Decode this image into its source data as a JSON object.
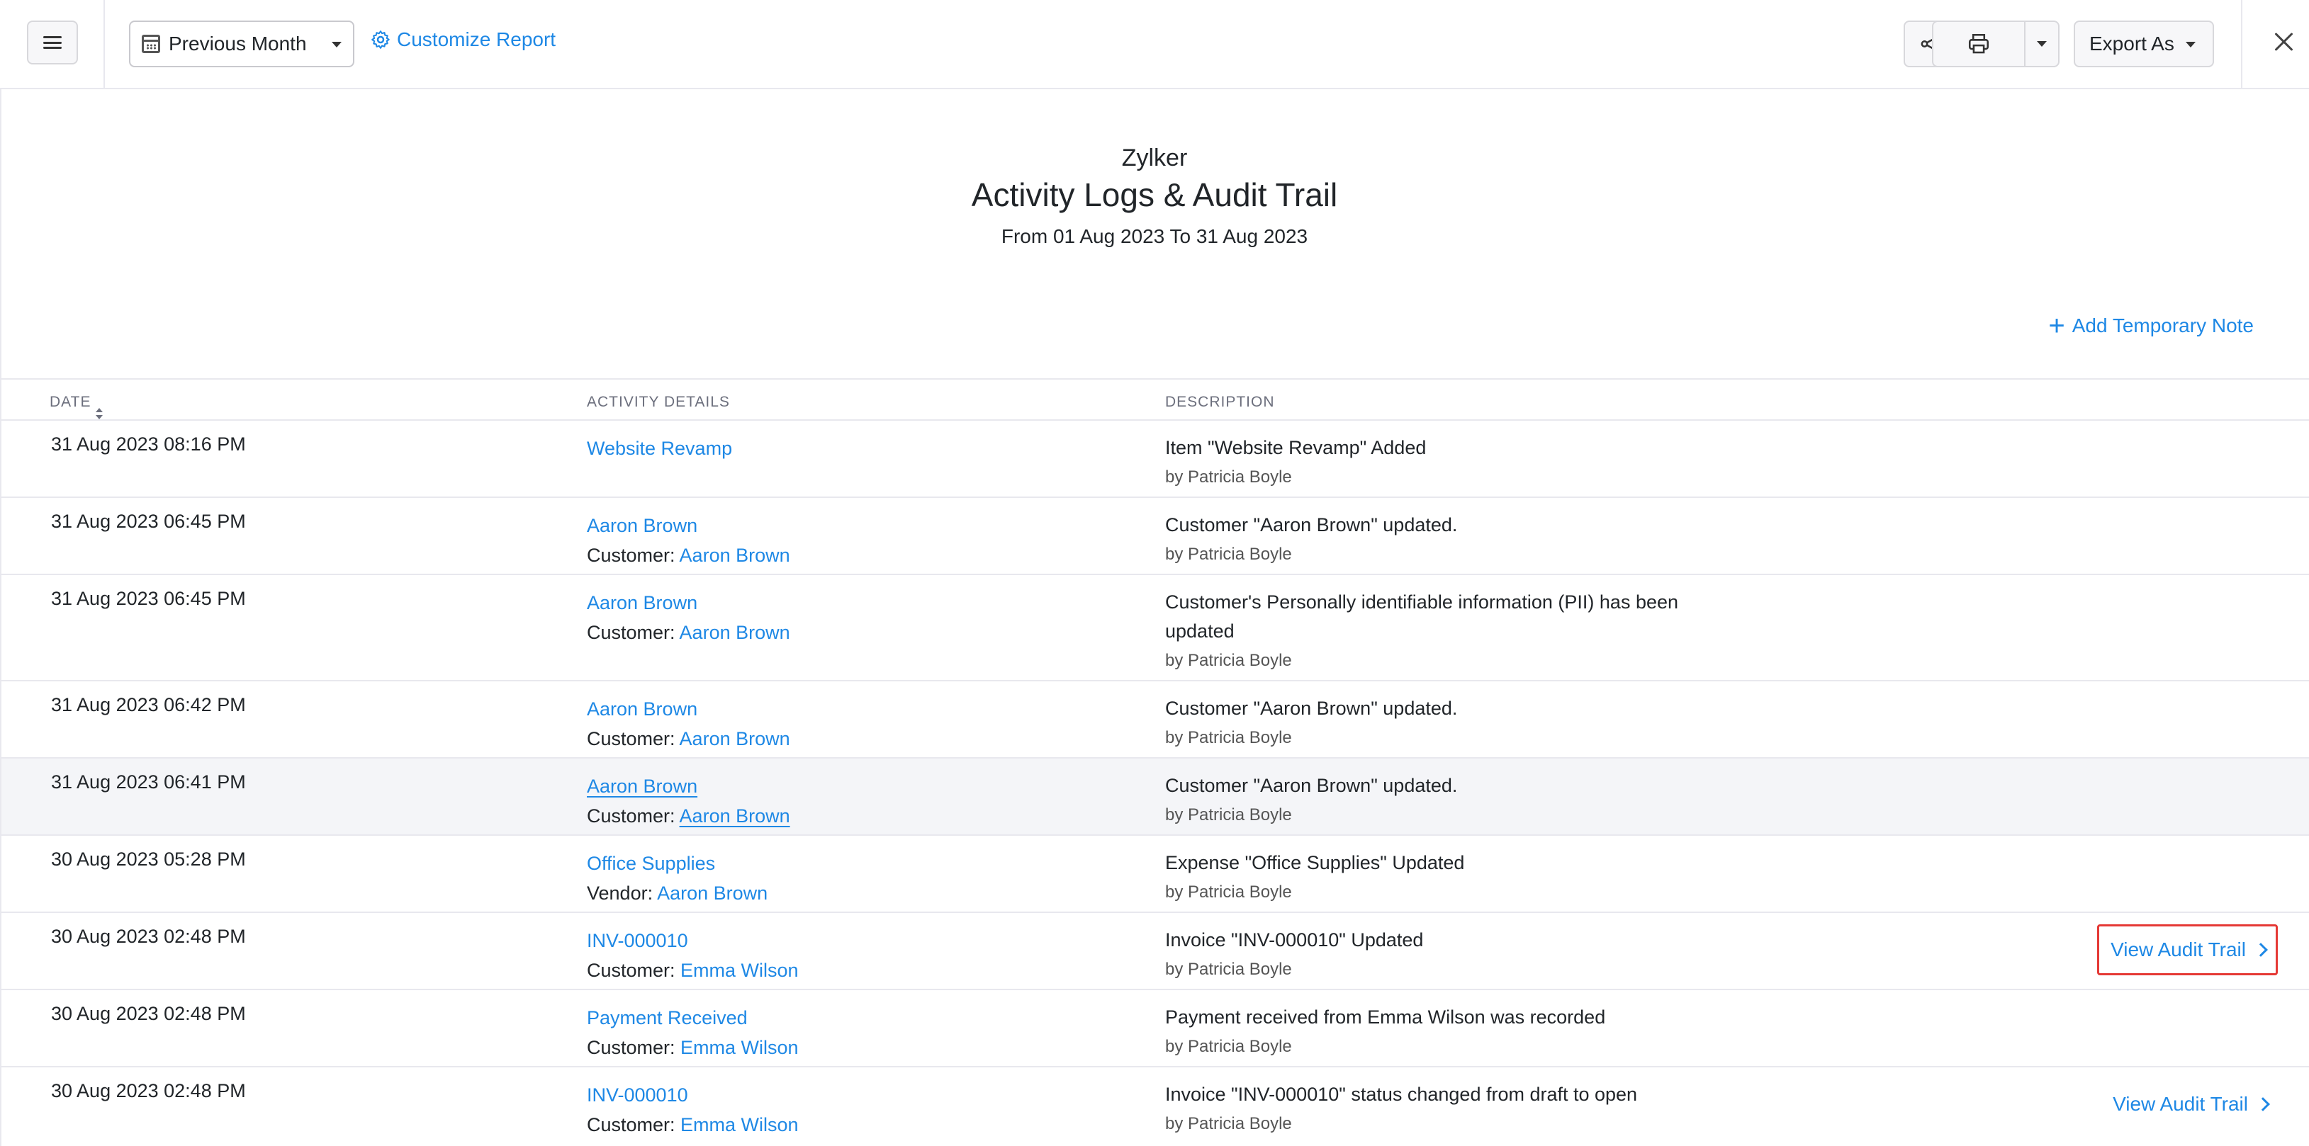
{
  "toolbar": {
    "period": "Previous Month",
    "customize_label": "Customize Report",
    "export_label": "Export As"
  },
  "report": {
    "organization": "Zylker",
    "title": "Activity Logs & Audit Trail",
    "range": "From 01 Aug 2023 To 31 Aug 2023",
    "add_note_label": "Add Temporary Note"
  },
  "table": {
    "columns": [
      "DATE",
      "ACTIVITY DETAILS",
      "DESCRIPTION"
    ],
    "rows": [
      {
        "date": "31 Aug 2023 08:16 PM",
        "activity": "Website Revamp",
        "sub_label": "",
        "sub_value": "",
        "description": "Item \"Website Revamp\" Added",
        "by": "by Patricia Boyle"
      },
      {
        "date": "31 Aug 2023 06:45 PM",
        "activity": "Aaron Brown",
        "sub_label": "Customer: ",
        "sub_value": "Aaron Brown",
        "description": "Customer \"Aaron Brown\" updated.",
        "by": "by Patricia Boyle"
      },
      {
        "date": "31 Aug 2023 06:45 PM",
        "activity": "Aaron Brown",
        "sub_label": "Customer: ",
        "sub_value": "Aaron Brown",
        "description": "Customer's Personally identifiable information (PII) has been updated",
        "by": "by Patricia Boyle"
      },
      {
        "date": "31 Aug 2023 06:42 PM",
        "activity": "Aaron Brown",
        "sub_label": "Customer: ",
        "sub_value": "Aaron Brown",
        "description": "Customer \"Aaron Brown\" updated.",
        "by": "by Patricia Boyle"
      },
      {
        "date": "31 Aug 2023 06:41 PM",
        "activity": "Aaron Brown",
        "sub_label": "Customer: ",
        "sub_value": "Aaron Brown",
        "description": "Customer \"Aaron Brown\" updated.",
        "by": "by Patricia Boyle"
      },
      {
        "date": "30 Aug 2023 05:28 PM",
        "activity": "Office Supplies",
        "sub_label": "Vendor: ",
        "sub_value": "Aaron Brown",
        "description": "Expense \"Office Supplies\" Updated",
        "by": "by Patricia Boyle"
      },
      {
        "date": "30 Aug 2023 02:48 PM",
        "activity": "INV-000010",
        "sub_label": "Customer: ",
        "sub_value": "Emma Wilson",
        "description": "Invoice \"INV-000010\" Updated",
        "by": "by Patricia Boyle",
        "audit_link": "View Audit Trail"
      },
      {
        "date": "30 Aug 2023 02:48 PM",
        "activity": "Payment Received",
        "sub_label": "Customer: ",
        "sub_value": "Emma Wilson",
        "description": "Payment received from Emma Wilson was recorded",
        "by": "by Patricia Boyle"
      },
      {
        "date": "30 Aug 2023 02:48 PM",
        "activity": "INV-000010",
        "sub_label": "Customer: ",
        "sub_value": "Emma Wilson",
        "description": "Invoice \"INV-000010\" status changed from draft to open",
        "by": "by Patricia Boyle",
        "audit_link": "View Audit Trail"
      }
    ]
  },
  "colors": {
    "link": "#1e88e5",
    "highlight_border": "#e53935",
    "row_hover": "#f4f5f8"
  },
  "icons": [
    "menu-icon",
    "calendar-icon",
    "gear-icon",
    "share-icon",
    "printer-icon",
    "chevron-down-icon",
    "close-icon",
    "plus-icon",
    "sort-icon",
    "chevron-right-icon"
  ]
}
